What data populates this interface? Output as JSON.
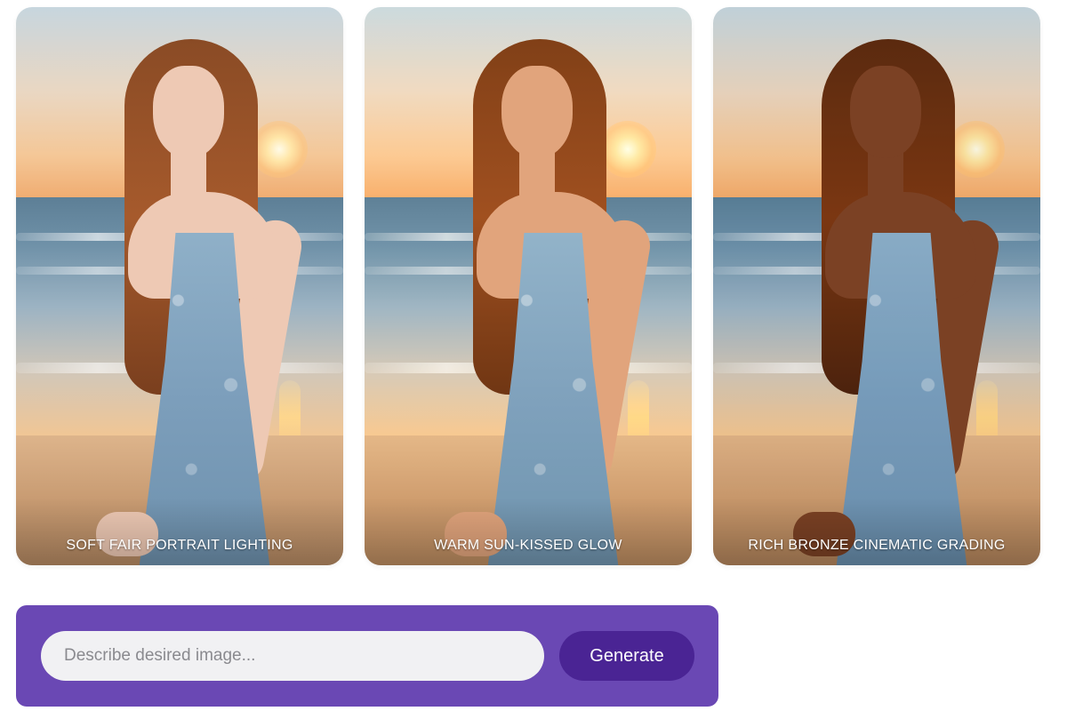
{
  "cards": [
    {
      "caption": "SOFT FAIR PORTRAIT LIGHTING",
      "tone": "fair"
    },
    {
      "caption": "WARM SUN-KISSED GLOW",
      "tone": "warm"
    },
    {
      "caption": "RICH BRONZE CINEMATIC GRADING",
      "tone": "bronze"
    }
  ],
  "prompt": {
    "placeholder": "Describe desired image...",
    "value": "",
    "generate_label": "Generate"
  },
  "colors": {
    "panel": "#6a48b4",
    "button": "#4a2494",
    "input_bg": "#f1f1f3"
  }
}
